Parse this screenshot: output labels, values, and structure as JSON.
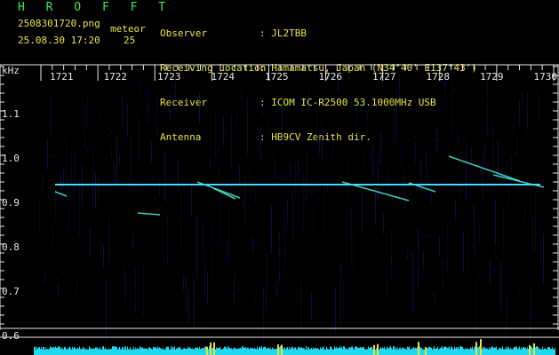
{
  "header": {
    "title": "H R O F F T",
    "filename": "2508301720.png",
    "datetime": "25.08.30 17:20",
    "meteor_label": "meteor",
    "meteor_count": "25"
  },
  "info": [
    {
      "label": "Observer",
      "value": ": JL2TBB"
    },
    {
      "label": "Receiving Location",
      "value": ": Hamamatsu, Japan (N34°40' E137°43')"
    },
    {
      "label": "Receiver",
      "value": ": ICOM IC-R2500 53.1000MHz USB"
    },
    {
      "label": "Antenna",
      "value": ": HB9CV Zenith dir."
    }
  ],
  "colors": {
    "text_green": "#37e85a",
    "text_yellow": "#e8e246",
    "text_white": "#e8e8e8",
    "axis": "#e8e8e8",
    "carrier": "#4ad8ff",
    "meteor_trace": "#40e0d0",
    "noise_bar": "#20d8f0",
    "noise_peak": "#f0e030"
  },
  "chart_data": {
    "type": "spectrogram",
    "ylabel": "kHz",
    "x_ticks": [
      "1721",
      "1722",
      "1723",
      "1724",
      "1725",
      "1726",
      "1727",
      "1728",
      "1729",
      "1730"
    ],
    "y_ticks": [
      "1.1",
      "1.0",
      "0.9",
      "0.8",
      "0.7",
      "0.6"
    ],
    "ylim": [
      0.6,
      1.1
    ],
    "carrier_khz": 0.94
  }
}
